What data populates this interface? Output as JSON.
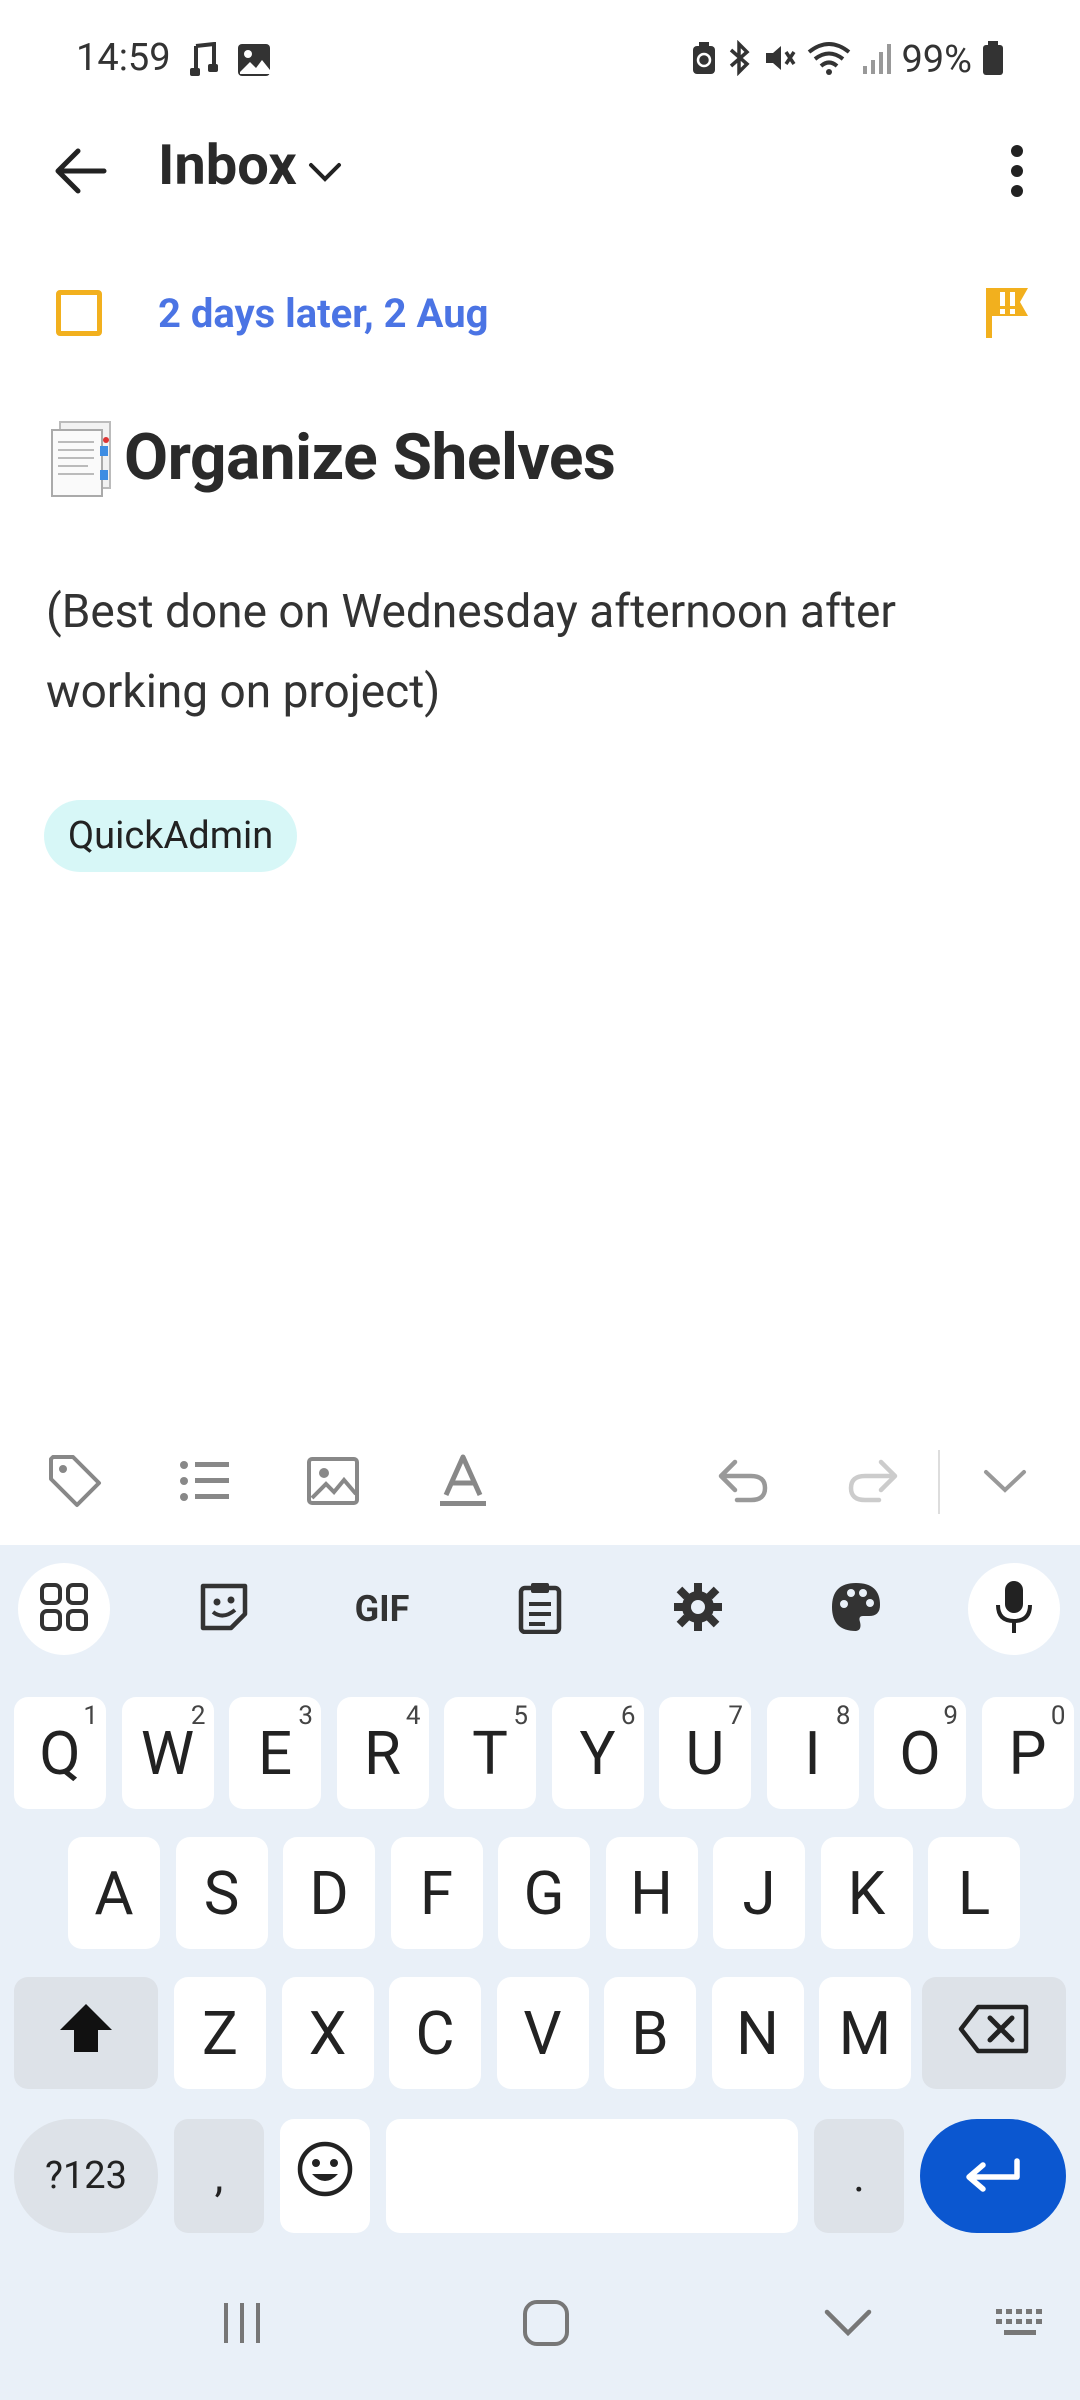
{
  "status_bar": {
    "time": "14:59",
    "battery_pct": "99%",
    "left_icons": [
      "music-icon",
      "image-icon"
    ],
    "right_icons": [
      "battery-saver-icon",
      "bluetooth-icon",
      "mute-icon",
      "wifi-icon",
      "signal-icon",
      "battery-icon"
    ]
  },
  "header": {
    "title": "Inbox",
    "back_icon": "arrow-left-icon",
    "dropdown_icon": "chevron-down-icon",
    "more_icon": "more-vert-icon"
  },
  "task": {
    "due_date": "2 days later, 2 Aug",
    "title": "Organize Shelves",
    "notes": "(Best done on Wednesday afternoon after working on project)",
    "tag": "QuickAdmin",
    "priority_color": "#f2b01e",
    "due_color": "#4b74e4"
  },
  "toolbar": {
    "items": [
      "tag-icon",
      "list-icon",
      "image-icon",
      "text-format-icon",
      "undo-icon",
      "redo-icon",
      "collapse-icon"
    ]
  },
  "keyboard": {
    "tools": [
      "apps-icon",
      "sticker-icon",
      "GIF",
      "clipboard-icon",
      "settings-icon",
      "palette-icon",
      "mic-icon"
    ],
    "gif_label": "GIF",
    "row1": [
      "Q",
      "W",
      "E",
      "R",
      "T",
      "Y",
      "U",
      "I",
      "O",
      "P"
    ],
    "row1_hints": [
      "1",
      "2",
      "3",
      "4",
      "5",
      "6",
      "7",
      "8",
      "9",
      "0"
    ],
    "row2": [
      "A",
      "S",
      "D",
      "F",
      "G",
      "H",
      "J",
      "K",
      "L"
    ],
    "row3": [
      "Z",
      "X",
      "C",
      "V",
      "B",
      "N",
      "M"
    ],
    "symbols_label": "?123",
    "comma": ",",
    "period": ".",
    "accent_color": "#0b57d0"
  },
  "nav_bar": {
    "items": [
      "recents-icon",
      "home-icon",
      "back-chevron-icon",
      "keyboard-icon"
    ]
  }
}
